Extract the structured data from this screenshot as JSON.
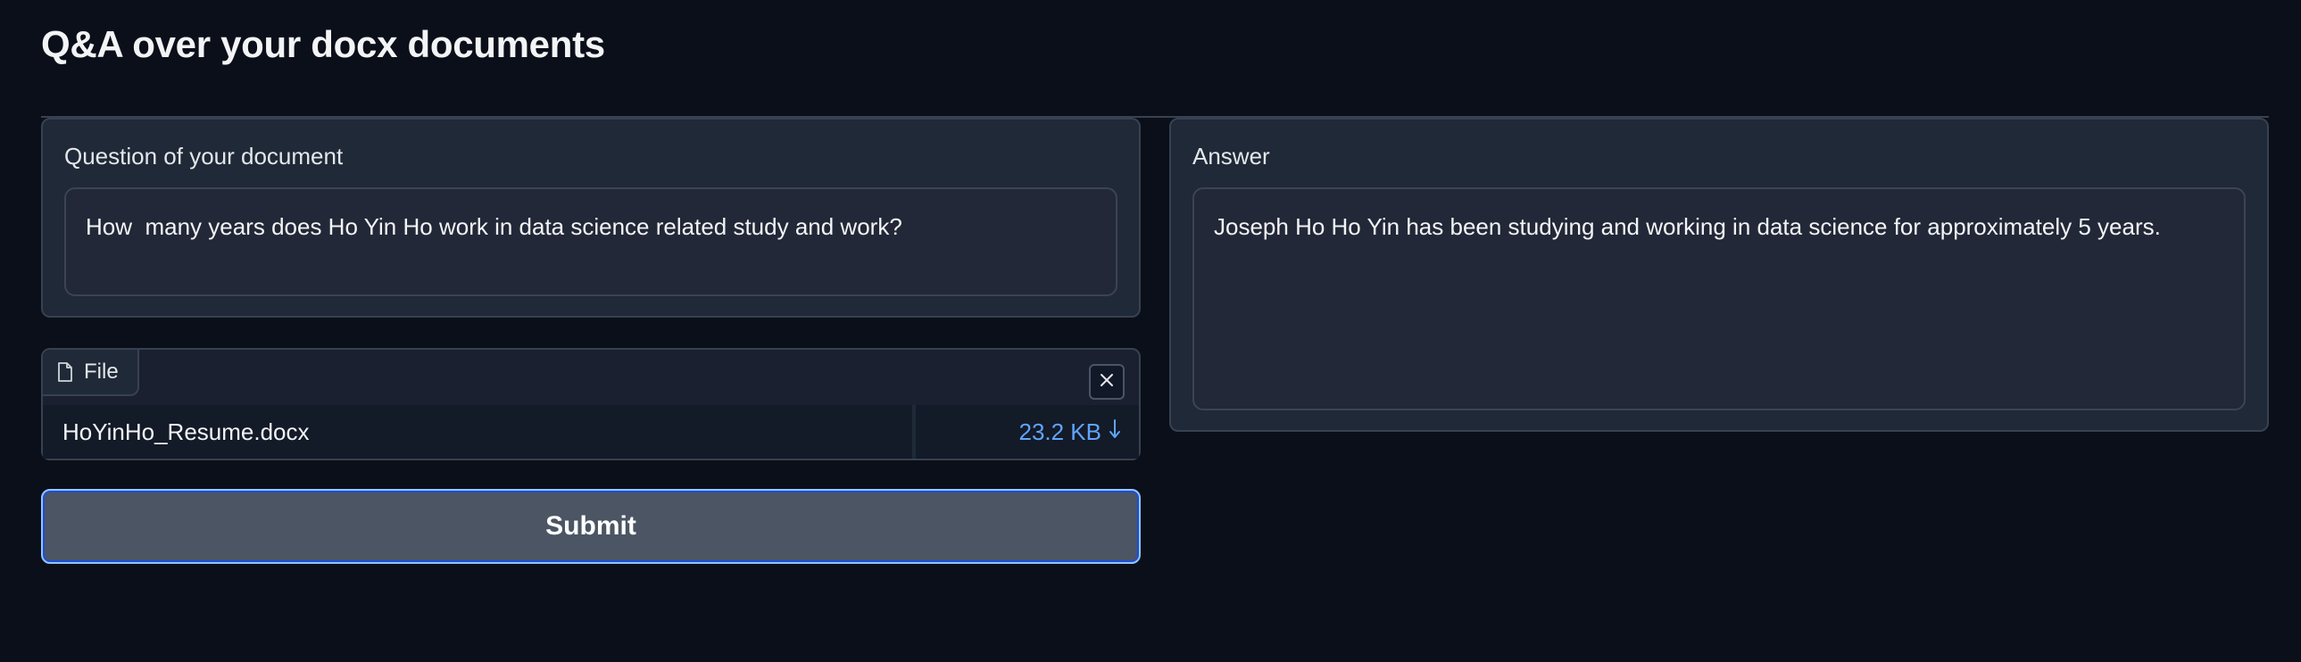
{
  "app": {
    "title": "Q&A over your docx documents"
  },
  "question": {
    "label": "Question of your document",
    "value": "How  many years does Ho Yin Ho work in data science related study and work?"
  },
  "file": {
    "tab_label": "File",
    "tab_icon": "file-icon",
    "close_icon": "close-icon",
    "name": "HoYinHo_Resume.docx",
    "size": "23.2 KB",
    "download_icon": "download-icon"
  },
  "submit": {
    "label": "Submit"
  },
  "answer": {
    "label": "Answer",
    "value": "Joseph Ho Ho Yin has been studying and working in data science for approximately 5 years."
  },
  "colors": {
    "background": "#0b0f19",
    "panel": "#1f2937",
    "accent": "#60a5fa",
    "submit_bg": "#4b5563"
  }
}
